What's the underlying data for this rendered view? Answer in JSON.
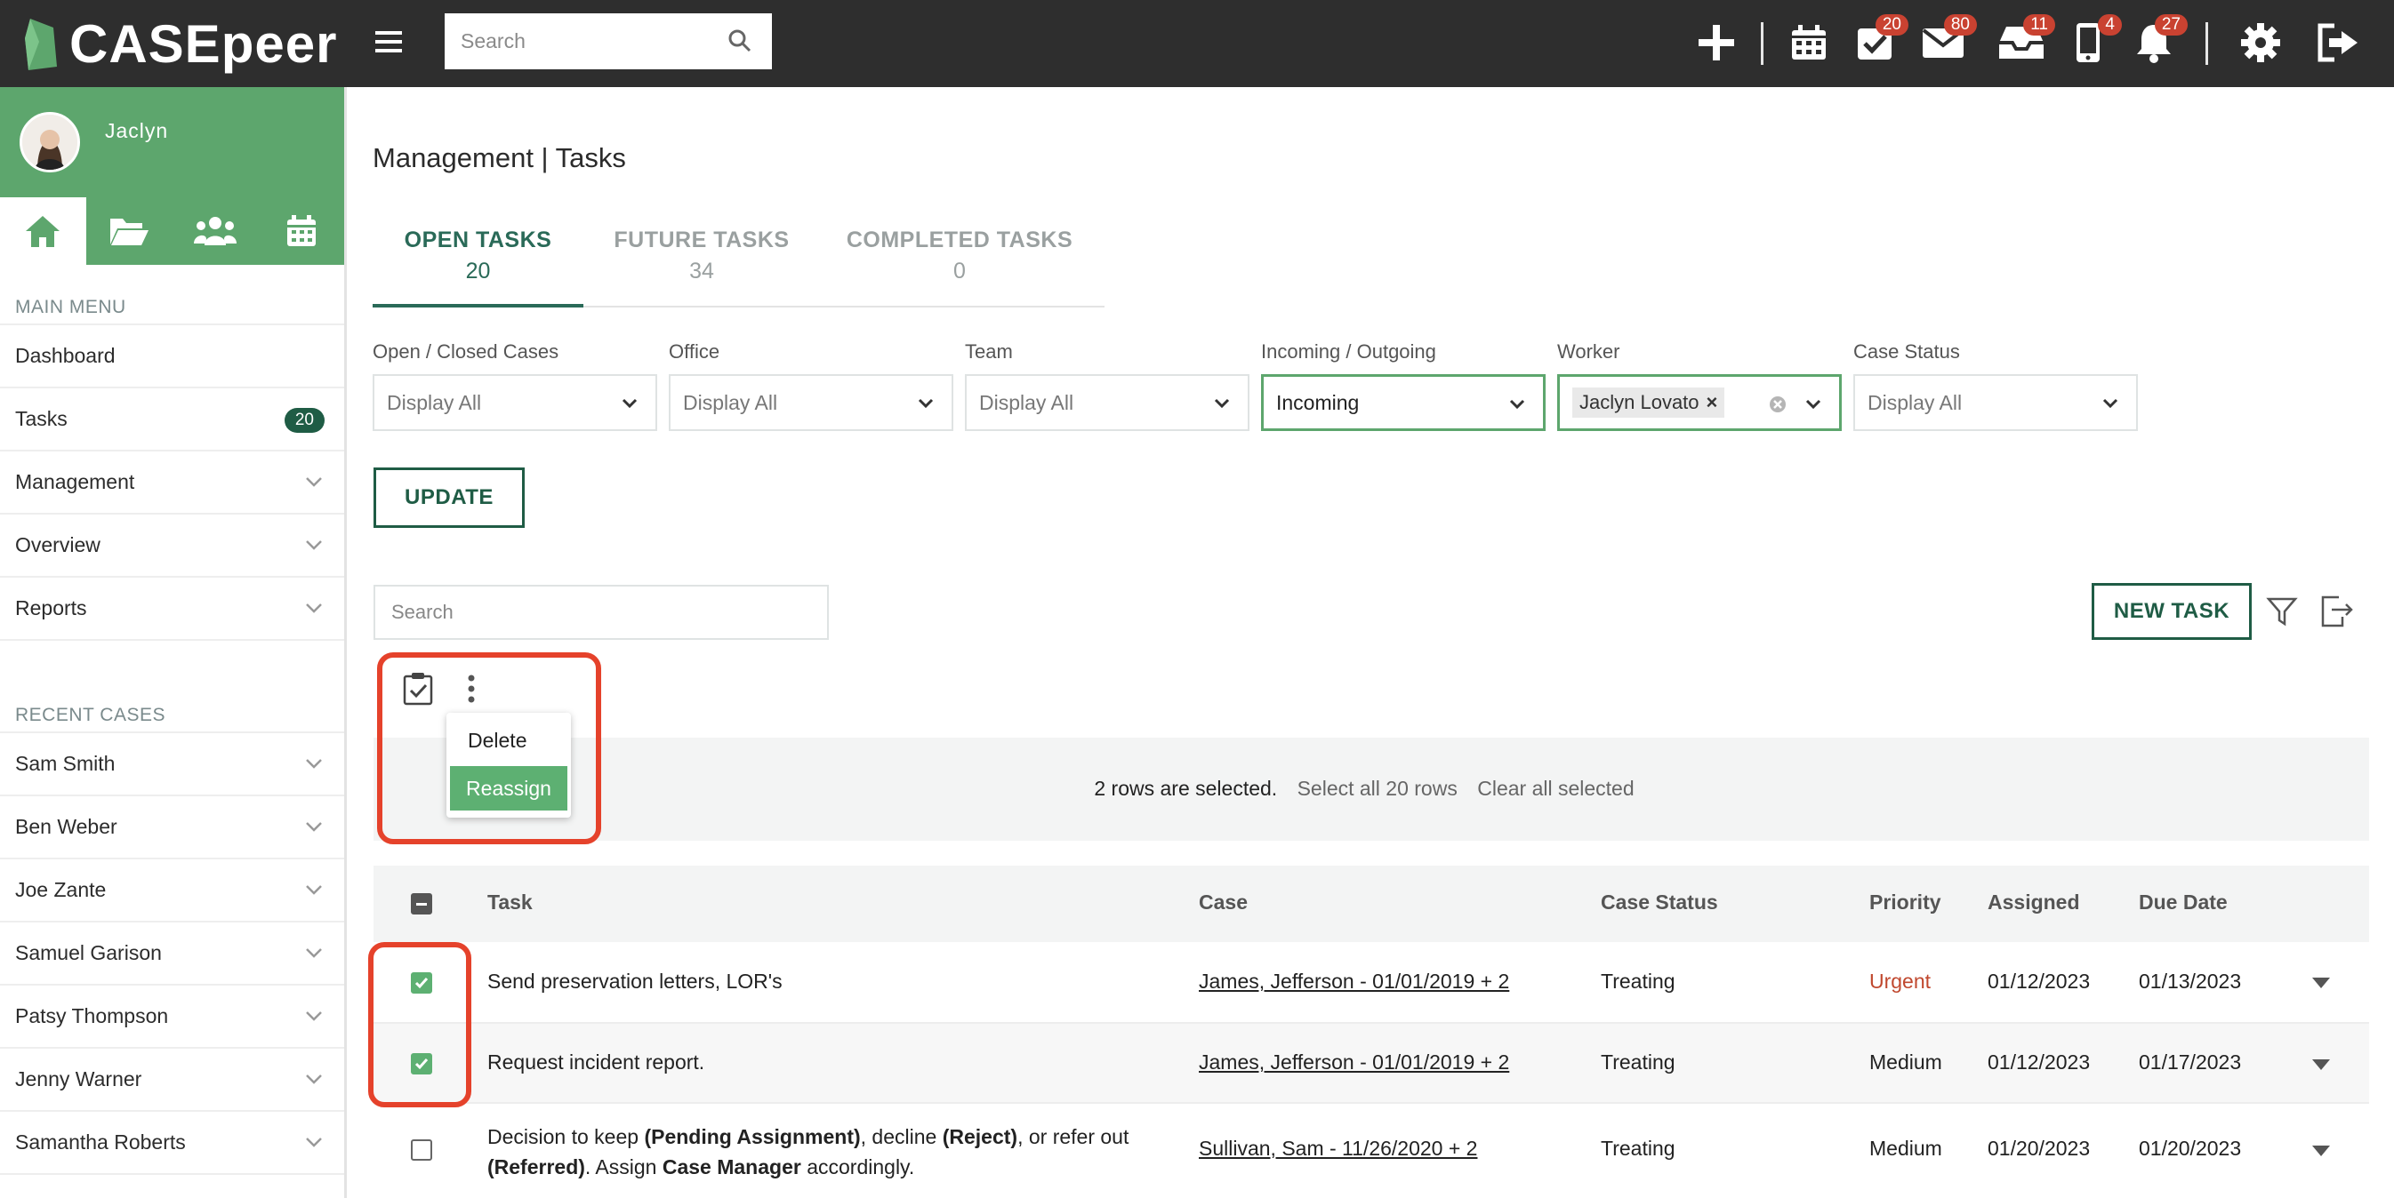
{
  "app": {
    "brand": "CASEpeer",
    "brand_color": "#5da66d",
    "accent_dark": "#1f5c45",
    "top_bar_color": "#2e2e2e"
  },
  "topbar": {
    "search_placeholder": "Search",
    "badges": {
      "tasks": "20",
      "mail": "80",
      "inbox": "11",
      "phone": "4",
      "notifications": "27"
    }
  },
  "sidebar": {
    "user_name": "Jaclyn",
    "main_menu_header": "MAIN MENU",
    "main_menu": [
      {
        "label": "Dashboard"
      },
      {
        "label": "Tasks",
        "badge": "20"
      },
      {
        "label": "Management"
      },
      {
        "label": "Overview"
      },
      {
        "label": "Reports"
      }
    ],
    "recent_header": "RECENT CASES",
    "recent_cases": [
      "Sam Smith",
      "Ben Weber",
      "Joe Zante",
      "Samuel Garison",
      "Patsy Thompson",
      "Jenny Warner",
      "Samantha Roberts"
    ]
  },
  "page": {
    "title": "Management | Tasks",
    "tabs": [
      {
        "label": "OPEN TASKS",
        "count": "20"
      },
      {
        "label": "FUTURE TASKS",
        "count": "34"
      },
      {
        "label": "COMPLETED TASKS",
        "count": "0"
      }
    ],
    "filters": [
      {
        "label": "Open / Closed Cases",
        "value": "Display All"
      },
      {
        "label": "Office",
        "value": "Display All"
      },
      {
        "label": "Team",
        "value": "Display All"
      },
      {
        "label": "Incoming / Outgoing",
        "value": "Incoming"
      },
      {
        "label": "Worker",
        "value": "Jaclyn Lovato"
      },
      {
        "label": "Case Status",
        "value": "Display All"
      }
    ],
    "update_label": "UPDATE",
    "table_search_placeholder": "Search",
    "new_task_label": "NEW TASK",
    "bulk_menu": {
      "delete": "Delete",
      "reassign": "Reassign"
    },
    "selection": {
      "count_text": "2 rows are selected.",
      "select_all": "Select all 20 rows",
      "clear_all": "Clear all selected"
    }
  },
  "table": {
    "columns": [
      "Task",
      "Case",
      "Case Status",
      "Priority",
      "Assigned",
      "Due Date"
    ],
    "rows": [
      {
        "task": "Send preservation letters, LOR's",
        "case": "James, Jefferson - 01/01/2019 + 2",
        "status": "Treating",
        "priority": "Urgent",
        "assigned": "01/12/2023",
        "due": "01/13/2023",
        "checked": true
      },
      {
        "task": "Request incident report.",
        "case": "James, Jefferson - 01/01/2019 + 2",
        "status": "Treating",
        "priority": "Medium",
        "assigned": "01/12/2023",
        "due": "01/17/2023",
        "checked": true
      },
      {
        "task_parts": [
          "Decision to keep ",
          "(Pending Assignment)",
          ", decline ",
          "(Reject)",
          ", or refer out ",
          "(Referred)",
          ".  Assign ",
          "Case Manager",
          " accordingly."
        ],
        "case": "Sullivan, Sam - 11/26/2020 + 2",
        "status": "Treating",
        "priority": "Medium",
        "assigned": "01/20/2023",
        "due": "01/20/2023",
        "checked": false
      }
    ]
  }
}
